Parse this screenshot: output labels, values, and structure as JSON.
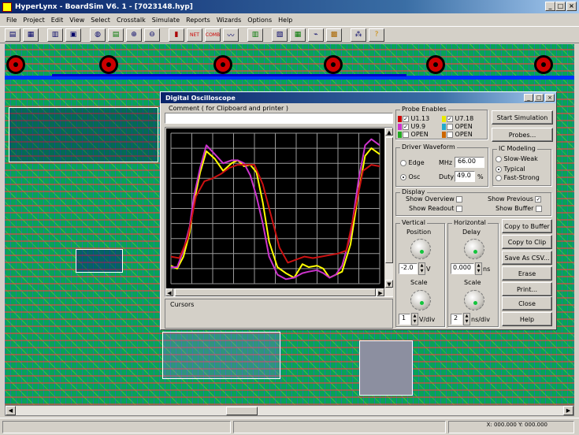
{
  "window": {
    "title": "HyperLynx - BoardSim V6. 1 - [7023148.hyp]"
  },
  "menu": [
    "File",
    "Project",
    "Edit",
    "View",
    "Select",
    "Crosstalk",
    "Simulate",
    "Reports",
    "Wizards",
    "Options",
    "Help"
  ],
  "toolbar_icons": [
    "open-board-icon",
    "board-wizard-icon",
    "select-nets-icon",
    "save-icon",
    "probe-icon",
    "stackup-icon",
    "zoom-in-icon",
    "zoom-out-icon",
    "terminator-icon",
    "net-icon",
    "crosstalk-icon",
    "oscilloscope-icon",
    "spectrum-icon",
    "rules-icon",
    "ic-model-icon",
    "view-icon",
    "help-icon"
  ],
  "toolbar_labels": {
    "net": "NET",
    "crosstalk": "COMB"
  },
  "colors": {
    "titlebar": "#0a246a",
    "scope_bg": "#000000",
    "trace_yellow": "#ffff00",
    "trace_magenta": "#cc33cc",
    "trace_red": "#cc1111",
    "pcb_green": "#07a357"
  },
  "oscilloscope": {
    "title": "Digital Oscilloscope",
    "comment_label": "Comment ( for Clipboard and printer )",
    "comment_value": "",
    "cursors_label": "Cursors",
    "probe_enables": {
      "label": "Probe Enables",
      "probes": [
        {
          "name": "U1.13",
          "checked": true,
          "color": "#cc0000"
        },
        {
          "name": "U7.18",
          "checked": true,
          "color": "#e8e800"
        },
        {
          "name": "U9.9",
          "checked": true,
          "color": "#cc33cc"
        },
        {
          "name": "OPEN",
          "checked": false,
          "color": "#22aacc"
        },
        {
          "name": "OPEN",
          "checked": false,
          "color": "#22aa22"
        },
        {
          "name": "OPEN",
          "checked": false,
          "color": "#cc6600"
        }
      ]
    },
    "driver_waveform": {
      "label": "Driver Waveform",
      "edge": "Edge",
      "osc": "Osc",
      "selected": "Osc",
      "mhz_label": "MHz",
      "mhz_value": "66.00",
      "duty_label": "Duty",
      "duty_value": "49.0",
      "duty_unit": "%"
    },
    "ic_modeling": {
      "label": "IC Modeling",
      "options": [
        "Slow-Weak",
        "Typical",
        "Fast-Strong"
      ],
      "selected": "Typical"
    },
    "display": {
      "label": "Display",
      "show_overview": "Show Overview",
      "show_previous": "Show Previous",
      "show_readout": "Show Readout",
      "show_buffer": "Show Buffer",
      "show_previous_checked": true
    },
    "vertical": {
      "label": "Vertical",
      "position_label": "Position",
      "position_value": "-2.0",
      "position_unit": "V",
      "scale_label": "Scale",
      "scale_value": "1",
      "scale_unit": "V/div"
    },
    "horizontal": {
      "label": "Horizontal",
      "delay_label": "Delay",
      "delay_value": "0.000",
      "delay_unit": "ns",
      "scale_label": "Scale",
      "scale_value": "2",
      "scale_unit": "ns/div"
    },
    "buttons": {
      "start": "Start Simulation",
      "probes": "Probes...",
      "copy_buffer": "Copy to Buffer",
      "copy_clip": "Copy to Clip",
      "save_csv": "Save As CSV...",
      "erase": "Erase",
      "print": "Print...",
      "close": "Close",
      "help": "Help"
    }
  },
  "chart_data": {
    "type": "line",
    "title": "",
    "xlabel": "",
    "ylabel": "",
    "x_divisions": 10,
    "y_divisions": 10,
    "xlim": [
      0,
      20
    ],
    "ylim": [
      -2,
      8
    ],
    "x_unit": "ns",
    "y_unit": "V",
    "grid": true,
    "series": [
      {
        "color": "#ffff00",
        "x": [
          0,
          0.6,
          1.2,
          1.8,
          2.2,
          2.8,
          3.4,
          4.2,
          5.0,
          5.8,
          6.4,
          7.0,
          7.6,
          8.2,
          8.8,
          9.4,
          10.2,
          11.0,
          11.8,
          12.6,
          13.2,
          14.0,
          14.6,
          15.2,
          15.8,
          16.4,
          17.2,
          18.0,
          18.6,
          19.2,
          20
        ],
        "y": [
          -0.8,
          -1.0,
          -0.2,
          1.4,
          3.4,
          5.4,
          6.8,
          6.3,
          5.5,
          6.0,
          6.2,
          5.8,
          5.9,
          5.4,
          3.4,
          0.8,
          -0.9,
          -1.3,
          -1.6,
          -0.7,
          -0.9,
          -0.8,
          -1.0,
          -1.6,
          -1.4,
          -1.2,
          0.6,
          4.2,
          6.5,
          7.0,
          6.6
        ]
      },
      {
        "color": "#cc33cc",
        "x": [
          0,
          0.6,
          1.2,
          1.8,
          2.2,
          2.8,
          3.4,
          4.2,
          5.0,
          5.8,
          6.4,
          7.0,
          7.6,
          8.2,
          8.8,
          9.4,
          10.2,
          11.0,
          11.8,
          12.6,
          13.2,
          14.0,
          14.6,
          15.2,
          15.8,
          16.4,
          17.2,
          18.0,
          18.6,
          19.2,
          20
        ],
        "y": [
          -0.9,
          -0.9,
          0.2,
          1.8,
          3.8,
          5.7,
          7.2,
          6.6,
          6.0,
          6.2,
          6.2,
          6.0,
          5.2,
          3.8,
          2.0,
          -0.2,
          -1.4,
          -1.7,
          -1.6,
          -1.3,
          -1.2,
          -1.1,
          -1.3,
          -1.6,
          -1.4,
          -0.8,
          1.2,
          5.0,
          7.2,
          7.6,
          7.2
        ]
      },
      {
        "color": "#cc1111",
        "x": [
          0,
          0.8,
          1.6,
          2.4,
          3.2,
          4.0,
          4.8,
          5.6,
          6.4,
          7.2,
          8.0,
          8.8,
          9.6,
          10.4,
          11.2,
          12.0,
          12.8,
          13.6,
          14.4,
          15.2,
          16.0,
          16.8,
          17.6,
          18.4,
          19.2,
          20
        ],
        "y": [
          -0.2,
          -0.3,
          1.0,
          3.8,
          4.8,
          5.0,
          5.3,
          5.7,
          5.9,
          5.9,
          5.9,
          4.6,
          2.5,
          0.4,
          -0.6,
          -0.4,
          -0.2,
          -0.3,
          -0.2,
          -0.1,
          0.0,
          0.2,
          2.8,
          5.5,
          5.9,
          5.8
        ]
      }
    ]
  },
  "status": {
    "coords": "X: 000.000   Y: 000.000"
  }
}
